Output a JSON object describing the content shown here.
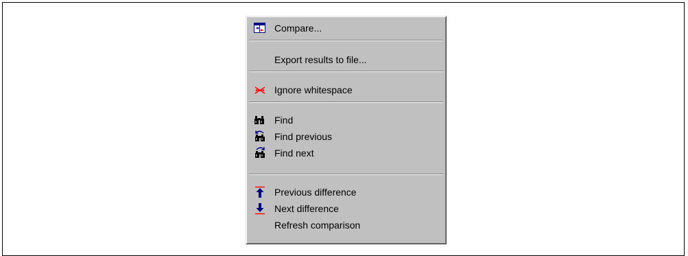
{
  "menu": {
    "items": [
      {
        "label": "Compare...",
        "icon": "compare-icon"
      },
      {
        "label": "Export results to file...",
        "icon": ""
      },
      {
        "label": "Ignore whitespace",
        "icon": "ignore-whitespace-icon"
      },
      {
        "label": "Find",
        "icon": "binoculars-icon"
      },
      {
        "label": "Find previous",
        "icon": "find-previous-icon"
      },
      {
        "label": "Find next",
        "icon": "find-next-icon"
      },
      {
        "label": "Previous difference",
        "icon": "arrow-up-icon"
      },
      {
        "label": "Next difference",
        "icon": "arrow-down-icon"
      },
      {
        "label": "Refresh comparison",
        "icon": ""
      }
    ]
  },
  "colors": {
    "menu_face": "#c0c0c0",
    "icon_blue": "#000080",
    "icon_red": "#ff0000"
  }
}
